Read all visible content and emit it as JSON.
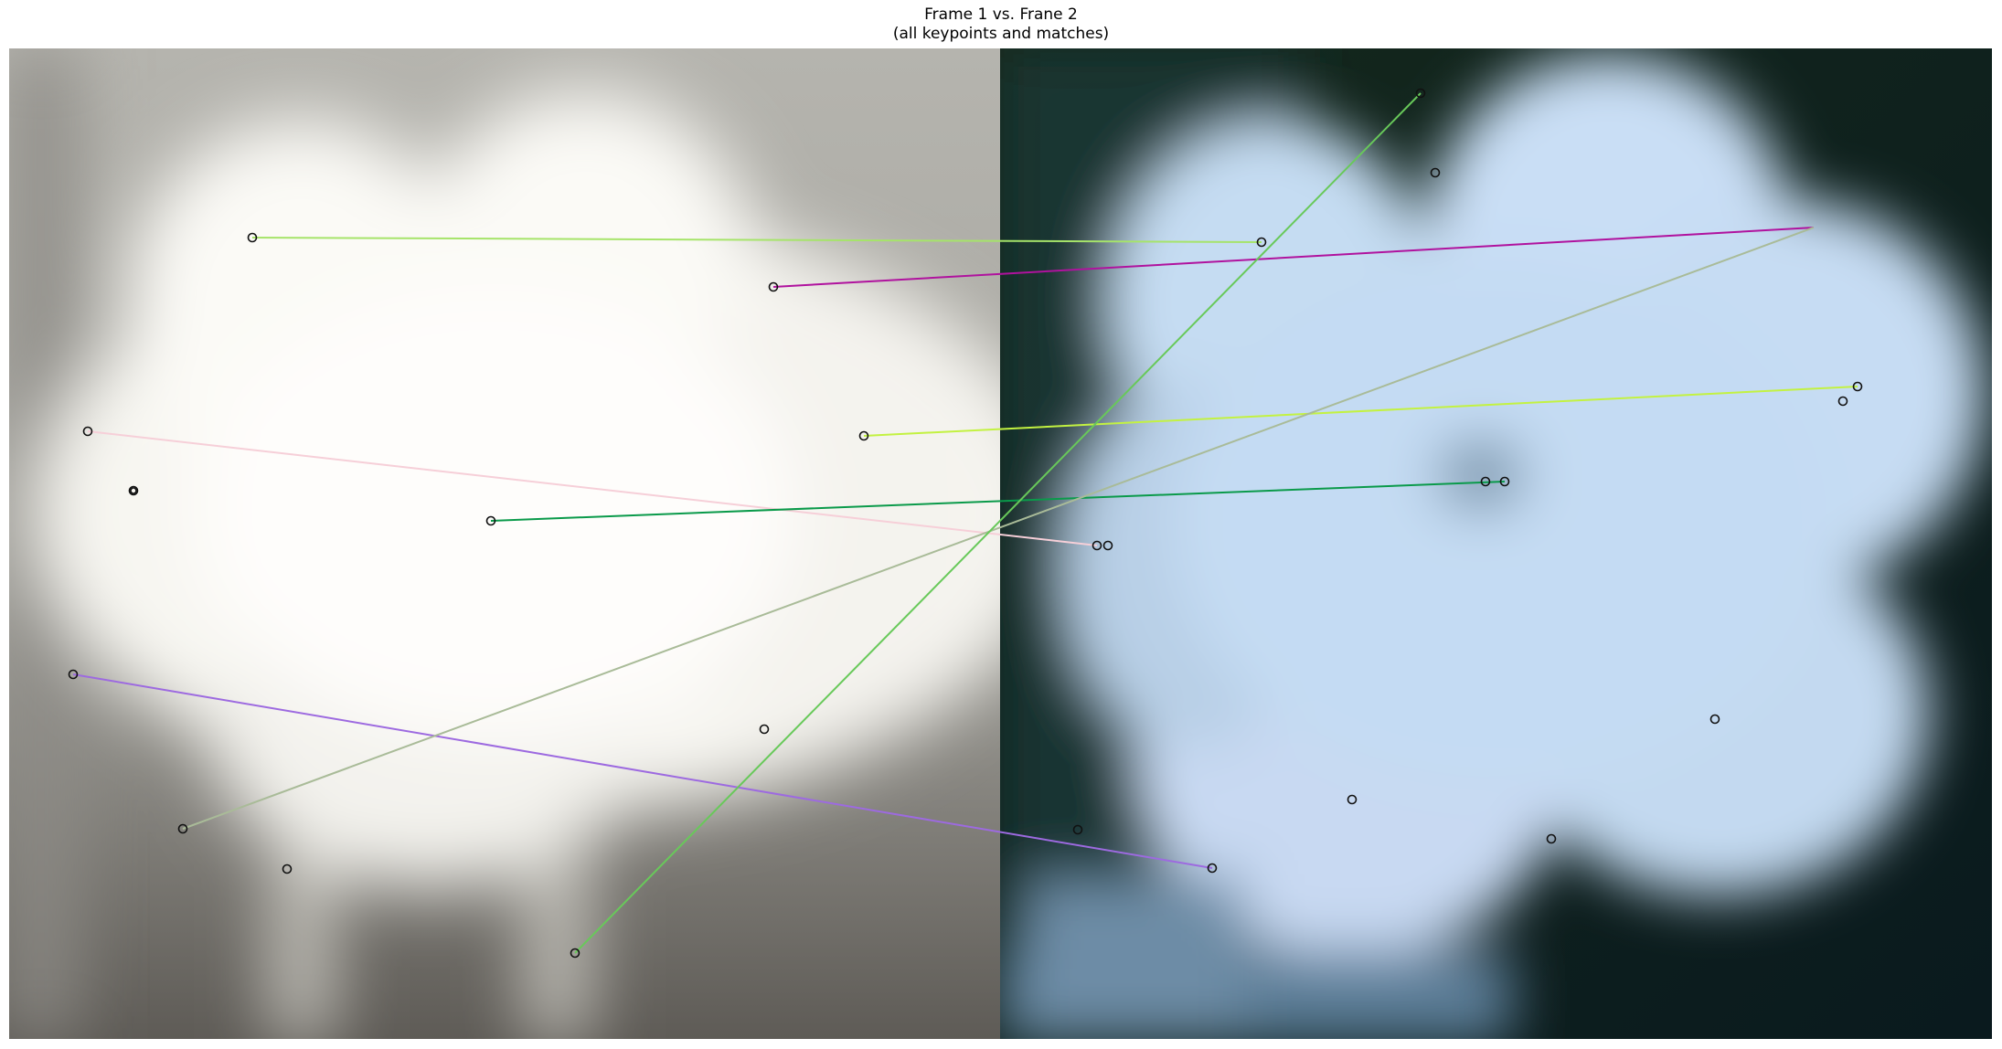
{
  "figure": {
    "title_line1": "Frame 1 vs. Frane 2",
    "title_line2": "(all keypoints and matches)"
  },
  "frames": [
    {
      "name": "Frame 1",
      "tone": "grayscale",
      "background": "#a9a8a2",
      "blob": "#fdfcf8"
    },
    {
      "name": "Frane 2",
      "tone": "blue",
      "background": "#0c1c1c",
      "blob": "#c8def4"
    }
  ],
  "keypoint_style": {
    "stroke": "#111111",
    "fill": "none"
  },
  "matches": [
    {
      "color": "#a6e46a"
    },
    {
      "color": "#b0129e"
    },
    {
      "color": "#f6cfd8"
    },
    {
      "color": "#c3f241"
    },
    {
      "color": "#0a9a4a"
    },
    {
      "color": "#9d6ae0"
    },
    {
      "color": "#a9bb98"
    },
    {
      "color": "#68c95a"
    }
  ]
}
